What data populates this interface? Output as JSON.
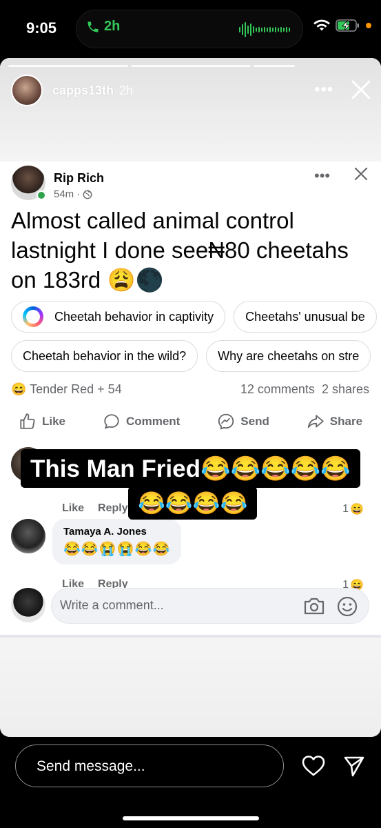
{
  "status": {
    "time": "9:05",
    "call_duration": "2h"
  },
  "story": {
    "username": "capps13th",
    "age": "2h"
  },
  "post": {
    "author": "Rip Rich",
    "time": "54m",
    "text": "Almost called animal control lastnight I done see₦80 cheetahs on 183rd 😩🌑",
    "chips_row1": [
      "Cheetah behavior in captivity",
      "Cheetahs' unusual be"
    ],
    "chips_row2": [
      "Cheetah behavior in the wild?",
      "Why are cheetahs on stre"
    ],
    "reactions_label": "Tender Red + 54",
    "comments_count": "12 comments",
    "shares_count": "2 shares",
    "actions": {
      "like": "Like",
      "comment": "Comment",
      "send": "Send",
      "share": "Share"
    }
  },
  "comments": [
    {
      "name": "",
      "text": "",
      "like": "Like",
      "reply": "Reply",
      "reaction_count": "1"
    },
    {
      "name": "Tamaya A. Jones",
      "text": "😂😂😭😭😂😂",
      "like": "Like",
      "reply": "Reply",
      "reaction_count": "1"
    }
  ],
  "comment_input": {
    "placeholder": "Write a comment..."
  },
  "caption": {
    "line1": "This Man Fried😂😂😂😂😂",
    "line2": "😂😂😂😂"
  },
  "message_bar": {
    "placeholder": "Send message..."
  },
  "icons": {
    "reaction": "grinning-face-emoji",
    "like": "thumbs-up-icon",
    "comment": "comment-bubble-icon",
    "send": "messenger-icon",
    "share": "share-arrow-icon"
  },
  "colors": {
    "online": "#31a24c",
    "call": "#34c759",
    "accent_orange": "#ff9500",
    "muted": "#65676b"
  }
}
